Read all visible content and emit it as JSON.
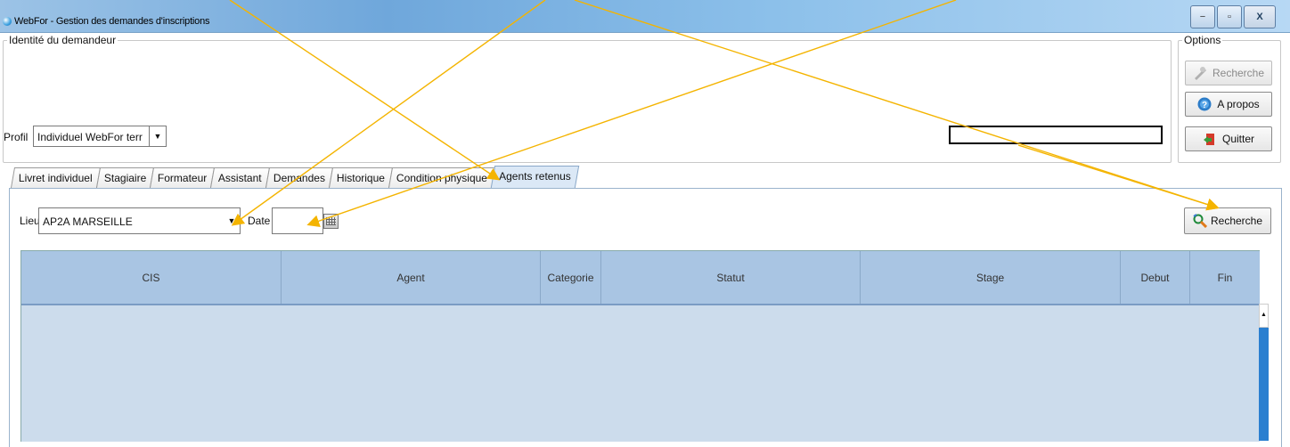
{
  "window": {
    "title": "WebFor - Gestion des demandes d'inscriptions",
    "minimize": "−",
    "maximize": "▫",
    "close": "X"
  },
  "identite": {
    "legend": "Identité du demandeur",
    "profil_label": "Profil",
    "profil_value": "Individuel WebFor terr"
  },
  "options": {
    "legend": "Options",
    "recherche": "Recherche",
    "apropos": "A propos",
    "quitter": "Quitter"
  },
  "tabs": [
    {
      "label": "Livret individuel"
    },
    {
      "label": "Stagiaire"
    },
    {
      "label": "Formateur"
    },
    {
      "label": "Assistant"
    },
    {
      "label": "Demandes"
    },
    {
      "label": "Historique"
    },
    {
      "label": "Condition physique"
    },
    {
      "label": "Agents retenus"
    }
  ],
  "active_tab": "Agents retenus",
  "filters": {
    "lieu_label": "Lieu",
    "lieu_value": "AP2A MARSEILLE",
    "date_label": "Date",
    "date_value": "",
    "search_label": "Recherche"
  },
  "grid": {
    "columns": [
      "CIS",
      "Agent",
      "Categorie",
      "Statut",
      "Stage",
      "Debut",
      "Fin"
    ],
    "rows": []
  },
  "colors": {
    "grid_header": "#a9c5e3",
    "grid_body": "#ccdcec",
    "annotation_arrow": "#f4b400"
  }
}
